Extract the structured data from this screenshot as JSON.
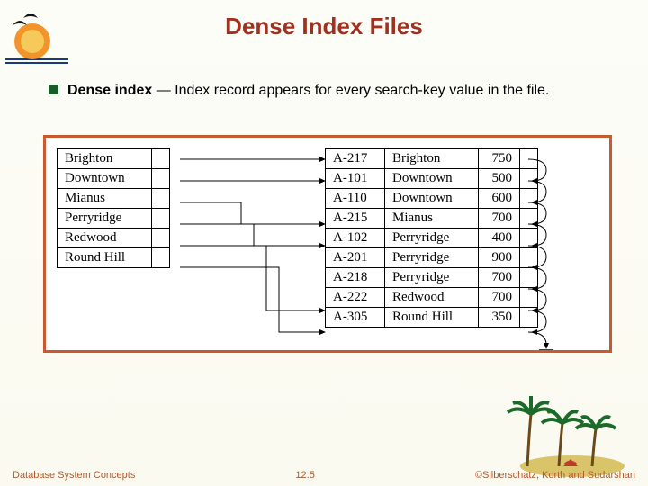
{
  "title": "Dense Index Files",
  "bullet": {
    "bold": "Dense index",
    "rest": " — Index record appears for every search-key value in the file."
  },
  "index_entries": [
    "Brighton",
    "Downtown",
    "Mianus",
    "Perryridge",
    "Redwood",
    "Round Hill"
  ],
  "data_rows": [
    {
      "acct": "A-217",
      "branch": "Brighton",
      "bal": "750"
    },
    {
      "acct": "A-101",
      "branch": "Downtown",
      "bal": "500"
    },
    {
      "acct": "A-110",
      "branch": "Downtown",
      "bal": "600"
    },
    {
      "acct": "A-215",
      "branch": "Mianus",
      "bal": "700"
    },
    {
      "acct": "A-102",
      "branch": "Perryridge",
      "bal": "400"
    },
    {
      "acct": "A-201",
      "branch": "Perryridge",
      "bal": "900"
    },
    {
      "acct": "A-218",
      "branch": "Perryridge",
      "bal": "700"
    },
    {
      "acct": "A-222",
      "branch": "Redwood",
      "bal": "700"
    },
    {
      "acct": "A-305",
      "branch": "Round Hill",
      "bal": "350"
    }
  ],
  "index_to_data": [
    0,
    1,
    3,
    4,
    7,
    8
  ],
  "footer": {
    "left": "Database System Concepts",
    "center": "12.5",
    "right": "©Silberschatz, Korth and Sudarshan"
  }
}
